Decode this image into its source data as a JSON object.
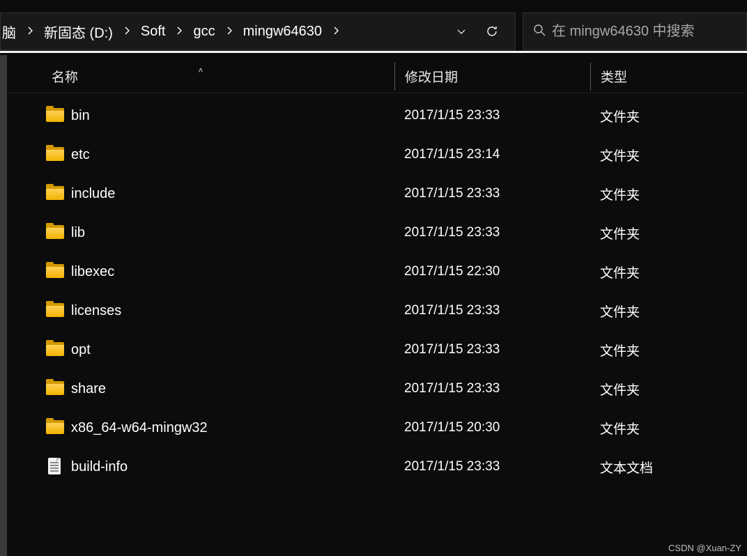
{
  "breadcrumbs": [
    {
      "label": "脑"
    },
    {
      "label": "新固态 (D:)"
    },
    {
      "label": "Soft"
    },
    {
      "label": "gcc"
    },
    {
      "label": "mingw64630"
    }
  ],
  "search": {
    "placeholder": "在 mingw64630 中搜索"
  },
  "columns": {
    "name": "名称",
    "date": "修改日期",
    "type": "类型"
  },
  "sort_indicator": "˄",
  "items": [
    {
      "icon": "folder",
      "name": "bin",
      "date": "2017/1/15 23:33",
      "type": "文件夹"
    },
    {
      "icon": "folder",
      "name": "etc",
      "date": "2017/1/15 23:14",
      "type": "文件夹"
    },
    {
      "icon": "folder",
      "name": "include",
      "date": "2017/1/15 23:33",
      "type": "文件夹"
    },
    {
      "icon": "folder",
      "name": "lib",
      "date": "2017/1/15 23:33",
      "type": "文件夹"
    },
    {
      "icon": "folder",
      "name": "libexec",
      "date": "2017/1/15 22:30",
      "type": "文件夹"
    },
    {
      "icon": "folder",
      "name": "licenses",
      "date": "2017/1/15 23:33",
      "type": "文件夹"
    },
    {
      "icon": "folder",
      "name": "opt",
      "date": "2017/1/15 23:33",
      "type": "文件夹"
    },
    {
      "icon": "folder",
      "name": "share",
      "date": "2017/1/15 23:33",
      "type": "文件夹"
    },
    {
      "icon": "folder",
      "name": "x86_64-w64-mingw32",
      "date": "2017/1/15 20:30",
      "type": "文件夹"
    },
    {
      "icon": "text",
      "name": "build-info",
      "date": "2017/1/15 23:33",
      "type": "文本文档"
    }
  ],
  "watermark": "CSDN @Xuan-ZY"
}
